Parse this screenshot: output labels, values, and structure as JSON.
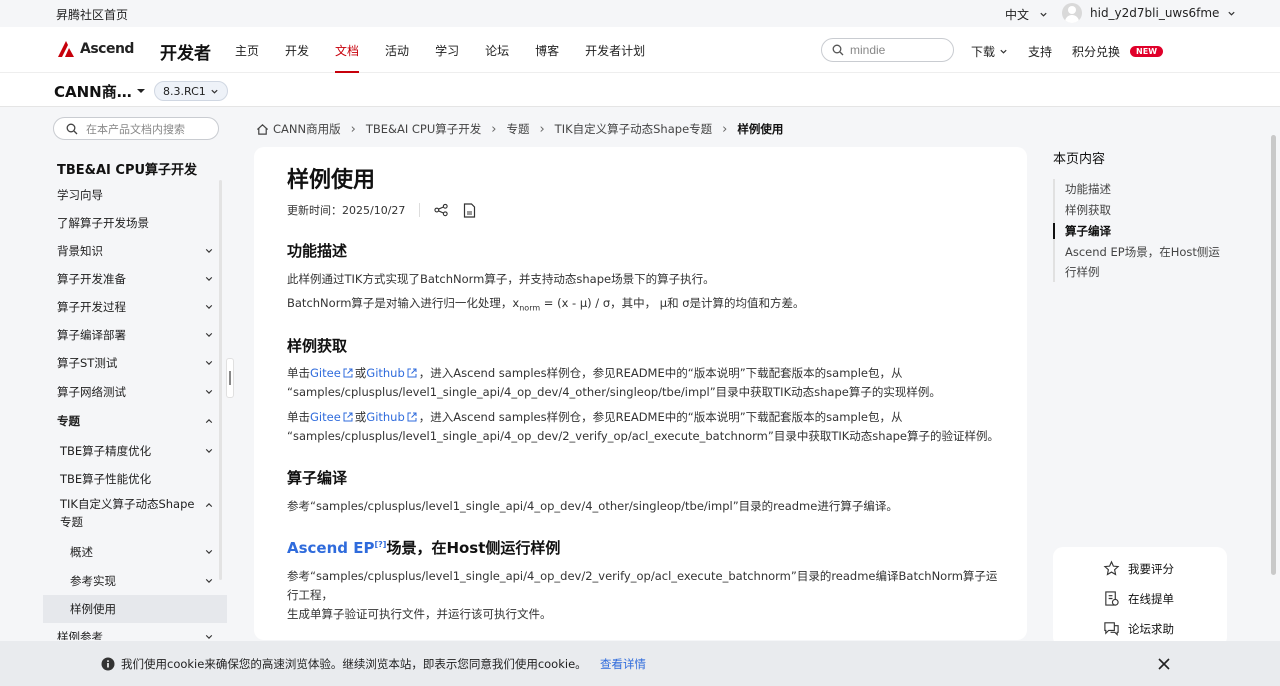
{
  "topbar": {
    "home_link": "昇腾社区首页",
    "language": "中文",
    "username": "hid_y2d7bli_uws6fme"
  },
  "nav": {
    "logo_text": "Ascend",
    "dev_title": "开发者",
    "items": [
      "主页",
      "开发",
      "文档",
      "活动",
      "学习",
      "论坛",
      "博客",
      "开发者计划"
    ],
    "active": "文档",
    "search_value": "mindie",
    "download": "下载",
    "support": "支持",
    "points": "积分兑换",
    "new_badge": "NEW"
  },
  "product": {
    "name": "CANN商…",
    "version": "8.3.RC1"
  },
  "sidebar": {
    "search_placeholder": "在本产品文档内搜索",
    "title": "TBE&AI CPU算子开发",
    "items": [
      {
        "label": "学习向导"
      },
      {
        "label": "了解算子开发场景"
      },
      {
        "label": "背景知识"
      },
      {
        "label": "算子开发准备"
      },
      {
        "label": "算子开发过程"
      },
      {
        "label": "算子编译部署"
      },
      {
        "label": "算子ST测试"
      },
      {
        "label": "算子网络测试"
      },
      {
        "label": "专题"
      },
      {
        "label": "TBE算子精度优化"
      },
      {
        "label": "TBE算子性能优化"
      },
      {
        "label": "TIK自定义算子动态Shape专题"
      },
      {
        "label": "概述"
      },
      {
        "label": "参考实现"
      },
      {
        "label": "样例使用"
      },
      {
        "label": "样例参考"
      }
    ]
  },
  "breadcrumb": [
    "CANN商用版",
    "TBE&AI CPU算子开发",
    "专题",
    "TIK自定义算子动态Shape专题",
    "样例使用"
  ],
  "doc": {
    "title": "样例使用",
    "updated_label": "更新时间：",
    "updated_date": "2025/10/27",
    "s1_title": "功能描述",
    "s1_p1": "此样例通过TIK方式实现了BatchNorm算子，并支持动态shape场景下的算子执行。",
    "s1_p2_a": "BatchNorm算子是对输入进行归一化处理，x",
    "s1_p2_sub": "norm",
    "s1_p2_b": " = (x - μ) / σ，其中， μ和 σ是计算的均值和方差。",
    "s2_title": "样例获取",
    "click": "单击",
    "gitee": "Gitee",
    "or": "或",
    "github": "Github",
    "s2_p1_rest": "，进入Ascend samples样例仓，参见README中的“版本说明”下载配套版本的sample包，从",
    "s2_p1_line2": "“samples/cplusplus/level1_single_api/4_op_dev/4_other/singleop/tbe/impl”目录中获取TIK动态shape算子的实现样例。",
    "s2_p2_rest": "，进入Ascend samples样例仓，参见README中的“版本说明”下载配套版本的sample包，从",
    "s2_p2_line2": "“samples/cplusplus/level1_single_api/4_op_dev/2_verify_op/acl_execute_batchnorm”目录中获取TIK动态shape算子的验证样例。",
    "s3_title": "算子编译",
    "s3_p": "参考“samples/cplusplus/level1_single_api/4_op_dev/4_other/singleop/tbe/impl”目录的readme进行算子编译。",
    "s4_title_blue": "Ascend EP",
    "s4_title_rest": "场景，在Host侧运行样例",
    "s4_p_line1": "参考“samples/cplusplus/level1_single_api/4_op_dev/2_verify_op/acl_execute_batchnorm”目录的readme编译BatchNorm算子运行工程，",
    "s4_p_line2": "生成单算子验证可执行文件，并运行该可执行文件。"
  },
  "toc": {
    "title": "本页内容",
    "items": [
      "功能描述",
      "样例获取",
      "算子编译",
      "Ascend EP场景，在Host侧运行样例"
    ],
    "active": "算子编译"
  },
  "feedback": {
    "rate": "我要评分",
    "online_ticket": "在线提单",
    "forum_help": "论坛求助"
  },
  "cookie": {
    "message": "我们使用cookie来确保您的高速浏览体验。继续浏览本站，即表示您同意我们使用cookie。",
    "details": "查看详情"
  },
  "colors": {
    "accent_red": "#c7000b",
    "link_blue": "#2f6bdc",
    "new_badge": "#e0002a"
  }
}
